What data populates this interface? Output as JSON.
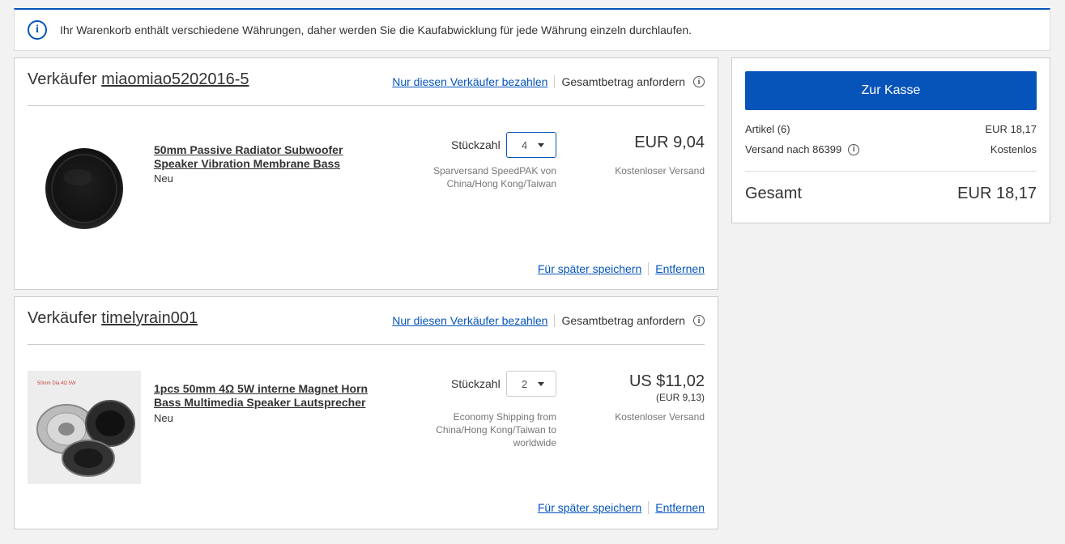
{
  "notice": {
    "icon": "info-icon",
    "text": "Ihr Warenkorb enthält verschiedene Währungen, daher werden Sie die Kaufabwicklung für jede Währung einzeln durchlaufen."
  },
  "sellers": [
    {
      "prefix": "Verkäufer",
      "name": "miaomiao5202016-5",
      "pay_link": "Nur diesen Verkäufer bezahlen",
      "request_total": "Gesamtbetrag anfordern",
      "item": {
        "title": "50mm Passive Radiator Subwoofer Speaker Vibration Membrane Bass",
        "condition": "Neu",
        "qty_label": "Stückzahl",
        "qty": "4",
        "shipping_method": "Sparversand SpeedPAK von China/Hong Kong/Taiwan",
        "price": "EUR 9,04",
        "shipping_cost": "Kostenloser Versand",
        "save_later": "Für später speichern",
        "remove": "Entfernen"
      }
    },
    {
      "prefix": "Verkäufer",
      "name": "timelyrain001",
      "pay_link": "Nur diesen Verkäufer bezahlen",
      "request_total": "Gesamtbetrag anfordern",
      "item": {
        "title": "1pcs 50mm 4Ω 5W interne Magnet Horn Bass Multimedia Speaker Lautsprecher",
        "image_label": "50mm Dia 4Ω 5W",
        "condition": "Neu",
        "qty_label": "Stückzahl",
        "qty": "2",
        "shipping_method": "Economy Shipping from China/Hong Kong/Taiwan to worldwide",
        "price": "US $11,02",
        "price_converted": "(EUR 9,13)",
        "shipping_cost": "Kostenloser Versand",
        "save_later": "Für später speichern",
        "remove": "Entfernen"
      }
    }
  ],
  "summary": {
    "checkout": "Zur Kasse",
    "items_label": "Artikel (6)",
    "items_value": "EUR 18,17",
    "shipping_label": "Versand nach 86399",
    "shipping_value": "Kostenlos",
    "total_label": "Gesamt",
    "total_value": "EUR 18,17"
  },
  "colors": {
    "accent": "#0654ba",
    "background": "#f2f2f2"
  }
}
